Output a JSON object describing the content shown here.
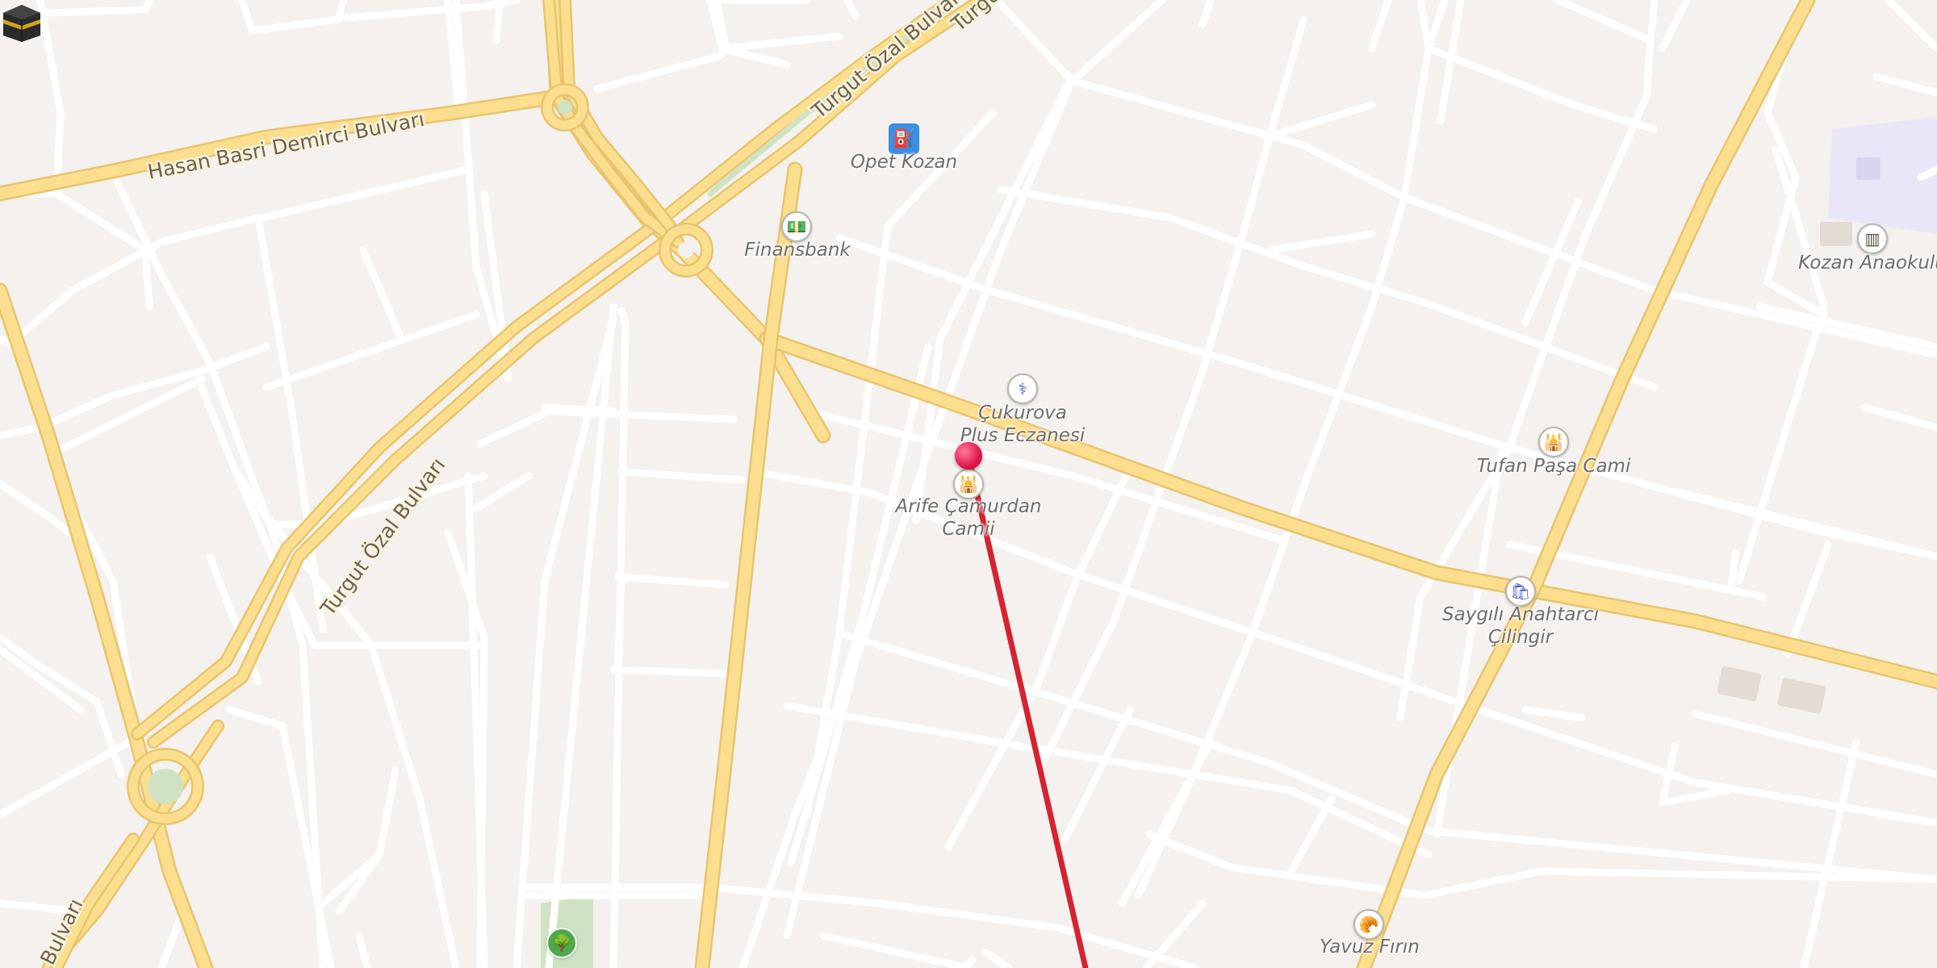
{
  "map": {
    "colors": {
      "background": "#f4f1ee",
      "minor_road": "#ffffff",
      "major_road": "#fbdf8e",
      "route_line": "#d7222f",
      "pin": "#e0174b",
      "park": "#cfe3c4",
      "school_area": "#e9e6f7"
    },
    "road_labels": {
      "hasan_basri": "Hasan Basri Demirci Bulvarı",
      "turgut_ozal_top": "Turgut Özal Bulvarı",
      "turgut_ozal_top_cut": "Turgut",
      "turgut_ozal_mid": "Turgut Özal Bulvarı",
      "turgut_ozal_bottom": "Bulvarı"
    },
    "pois": {
      "opet": {
        "label": "Opet Kozan",
        "icon": "fuel-icon"
      },
      "finansbank": {
        "label": "Finansbank",
        "icon": "bank-icon"
      },
      "eczane": {
        "label_line1": "Çukurova",
        "label_line2": "Plus Eczanesi",
        "icon": "pharmacy-icon"
      },
      "arife": {
        "label_line1": "Arife Çamurdan",
        "label_line2": "Camii",
        "icon": "mosque-icon"
      },
      "tufan": {
        "label": "Tufan Paşa Cami",
        "icon": "mosque-icon"
      },
      "saygili": {
        "label_line1": "Saygılı Anahtarcı",
        "label_line2": "Çilingir",
        "icon": "shop-icon"
      },
      "kozan_anaokulu": {
        "label": "Kozan Anaokulu",
        "icon": "school-icon"
      },
      "yavuz": {
        "label": "Yavuz Fırın",
        "icon": "bakery-icon"
      },
      "park": {
        "icon": "tree-icon"
      }
    },
    "markers": {
      "location_pin": "location-pin-icon",
      "qibla": "kaaba-icon"
    }
  }
}
